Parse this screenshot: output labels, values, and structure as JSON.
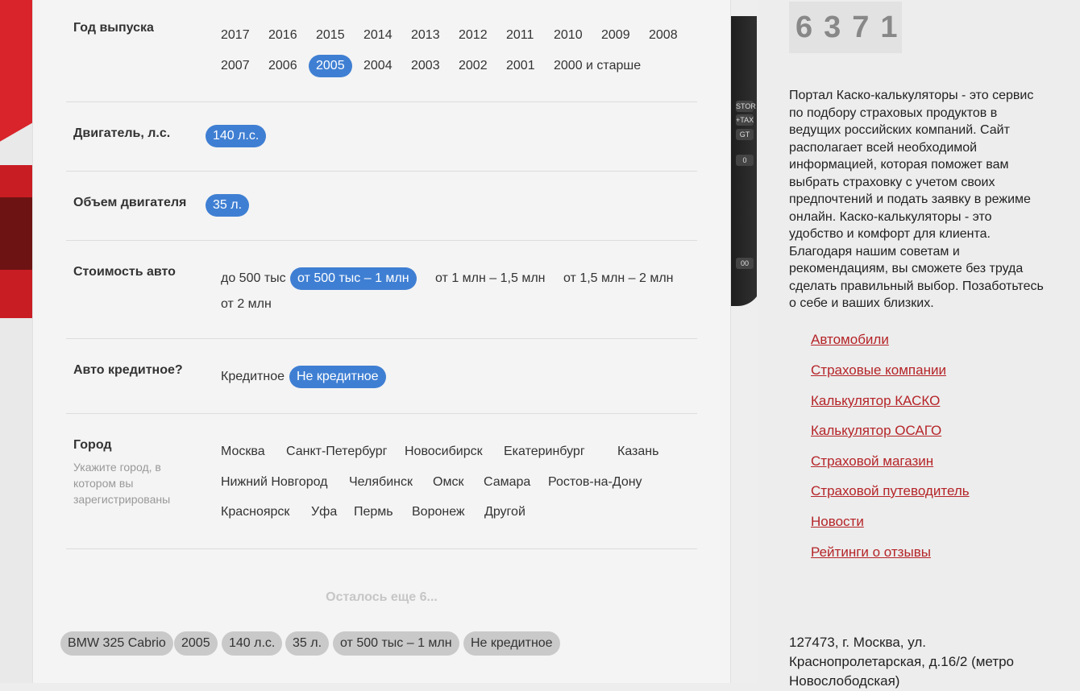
{
  "form": {
    "year": {
      "label": "Год выпуска",
      "options": [
        "2017",
        "2016",
        "2015",
        "2014",
        "2013",
        "2012",
        "2011",
        "2010",
        "2009",
        "2008",
        "2007",
        "2006",
        "2005",
        "2004",
        "2003",
        "2002",
        "2001",
        "2000 и старше"
      ],
      "selected": "2005"
    },
    "power": {
      "label": "Двигатель, л.с.",
      "options": [
        "140 л.с."
      ],
      "selected": "140 л.с."
    },
    "volume": {
      "label": "Объем двигателя",
      "options": [
        "35 л."
      ],
      "selected": "35 л."
    },
    "price": {
      "label": "Стоимость авто",
      "options": [
        "до 500 тыс",
        "от 500 тыс – 1 млн",
        "от 1 млн – 1,5 млн",
        "от 1,5 млн – 2 млн",
        "от 2 млн"
      ],
      "selected": "от 500 тыс – 1 млн"
    },
    "credit": {
      "label": "Авто кредитное?",
      "options": [
        "Кредитное",
        "Не кредитное"
      ],
      "selected": "Не кредитное"
    },
    "city": {
      "label": "Город",
      "hint": "Укажите город, в котором вы зарегистрированы",
      "options": [
        "Москва",
        "Санкт-Петербург",
        "Новосибирск",
        "Екатеринбург",
        "Казань",
        "Нижний Новгород",
        "Челябинск",
        "Омск",
        "Самара",
        "Ростов-на-Дону",
        "Красноярск",
        "Уфа",
        "Пермь",
        "Воронеж",
        "Другой"
      ]
    },
    "remaining": "Осталось еще 6...",
    "summary_tags": [
      "BMW 325 Cabrio",
      "2005",
      "140 л.с.",
      "35 л.",
      "от 500 тыс – 1 млн",
      "Не кредитное"
    ]
  },
  "sidebar": {
    "counter": "6371",
    "about": "Портал Каско-калькуляторы - это сервис по подбору страховых продуктов в ведущих российских компаний. Сайт располагает всей необходимой информацией, которая поможет вам выбрать страховку с учетом своих предпочтений и подать заявку в режиме онлайн. Каско-калькуляторы - это удобство и комфорт для клиента. Благодаря нашим советам и рекомендациям, вы сможете без труда сделать правильный выбор. Позаботьтесь о себе и ваших близких.",
    "links": [
      "Автомобили",
      "Страховые компании",
      "Калькулятор КАСКО",
      "Калькулятор ОСАГО",
      "Страховой магазин",
      "Страховой путеводитель",
      "Новости",
      "Рейтинги о отзывы"
    ],
    "address": "127473, г. Москва, ул. Краснопролетарская, д.16/2 (метро Новослободская)"
  },
  "colors": {
    "selected": "#3f7fd3",
    "link": "#b52428",
    "tag_bg": "#c9c9c9"
  },
  "background_calc_keys": [
    "STOR",
    "+TAX",
    "GT",
    "0",
    "00"
  ]
}
